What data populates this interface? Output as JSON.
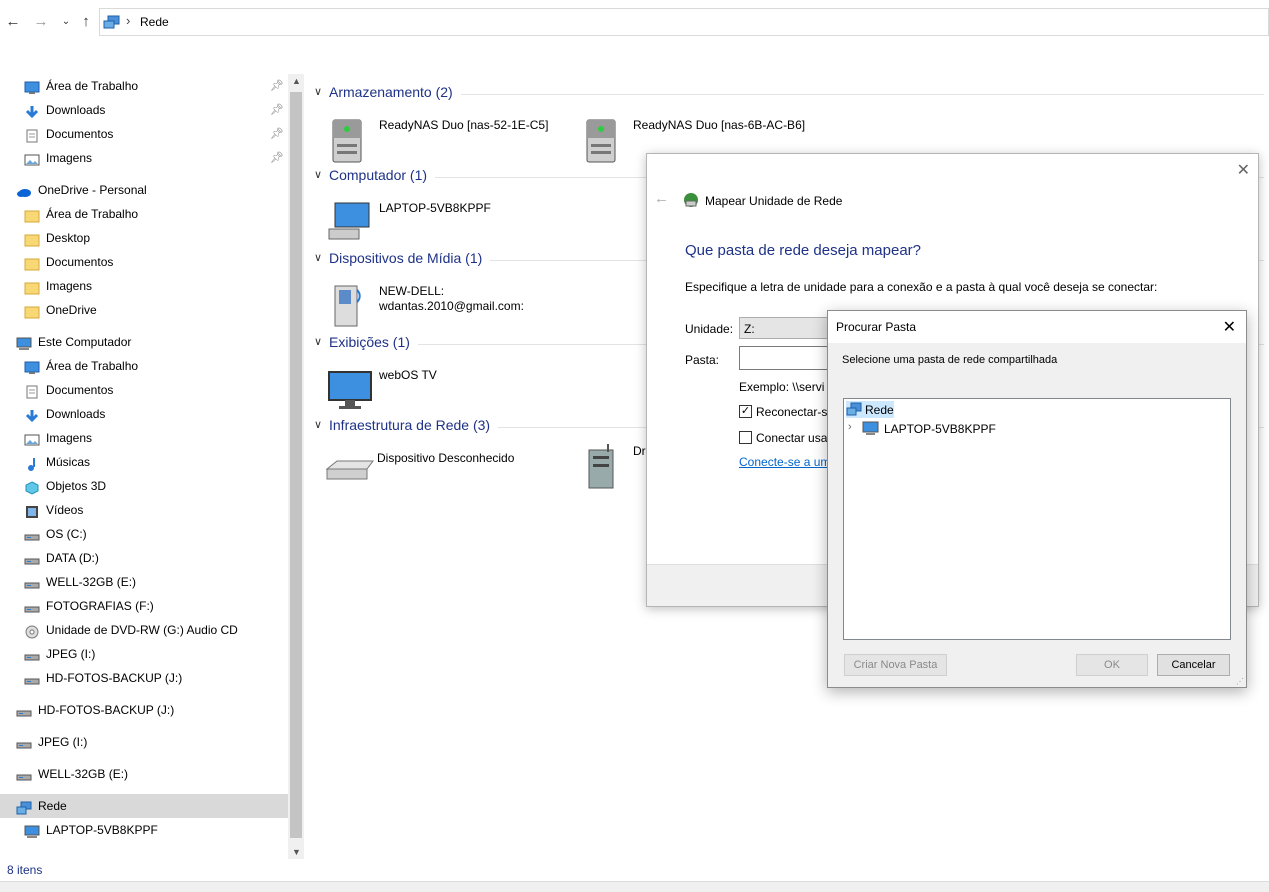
{
  "address": {
    "crumb": "Rede"
  },
  "sidebar": {
    "quick_access": [
      {
        "label": "Área de Trabalho",
        "icon": "desktop-icon"
      },
      {
        "label": "Downloads",
        "icon": "downloads-icon"
      },
      {
        "label": "Documentos",
        "icon": "documents-icon"
      },
      {
        "label": "Imagens",
        "icon": "pictures-icon"
      }
    ],
    "onedrive": {
      "label": "OneDrive - Personal"
    },
    "onedrive_items": [
      "Área de Trabalho",
      "Desktop",
      "Documentos",
      "Imagens",
      "OneDrive"
    ],
    "this_pc": {
      "label": "Este Computador"
    },
    "pc_items": [
      "Área de Trabalho",
      "Documentos",
      "Downloads",
      "Imagens",
      "Músicas",
      "Objetos 3D",
      "Vídeos",
      "OS (C:)",
      "DATA (D:)",
      "WELL-32GB (E:)",
      "FOTOGRAFIAS (F:)",
      "Unidade de DVD-RW (G:) Audio CD",
      "JPEG (I:)",
      "HD-FOTOS-BACKUP (J:)"
    ],
    "drives": [
      "HD-FOTOS-BACKUP (J:)",
      "JPEG (I:)",
      "WELL-32GB (E:)"
    ],
    "network": {
      "label": "Rede"
    },
    "network_items": [
      "LAPTOP-5VB8KPPF"
    ]
  },
  "content": {
    "groups": [
      {
        "title": "Armazenamento (2)"
      },
      {
        "title": "Computador (1)"
      },
      {
        "title": "Dispositivos de Mídia (1)"
      },
      {
        "title": "Exibições (1)"
      },
      {
        "title": "Infraestrutura de Rede (3)"
      }
    ],
    "storage": [
      "ReadyNAS Duo [nas-52-1E-C5]",
      "ReadyNAS Duo [nas-6B-AC-B6]"
    ],
    "computer": [
      "LAPTOP-5VB8KPPF"
    ],
    "media": {
      "line1": "NEW-DELL:",
      "line2": "wdantas.2010@gmail.com:"
    },
    "displays": [
      "webOS TV"
    ],
    "infra": [
      "Dispositivo Desconhecido",
      "Dr"
    ]
  },
  "status": {
    "count": "8 itens"
  },
  "map_dialog": {
    "title": "Mapear Unidade de Rede",
    "heading": "Que pasta de rede deseja mapear?",
    "description": "Especifique a letra de unidade para a conexão e a pasta à qual você deseja se conectar:",
    "drive_label": "Unidade:",
    "drive_value": "Z:",
    "folder_label": "Pasta:",
    "example": "Exemplo: \\\\servi",
    "reconnect": "Reconectar-se",
    "other_creds": "Conectar usan",
    "link": "Conecte-se a um"
  },
  "browse_dialog": {
    "title": "Procurar Pasta",
    "instruction": "Selecione uma pasta de rede compartilhada",
    "tree_root": "Rede",
    "tree_child": "LAPTOP-5VB8KPPF",
    "new_folder": "Criar Nova Pasta",
    "ok": "OK",
    "cancel": "Cancelar"
  },
  "colors": {
    "accent": "#1e3287",
    "link": "#0066cc",
    "selection": "#cce8ff"
  }
}
